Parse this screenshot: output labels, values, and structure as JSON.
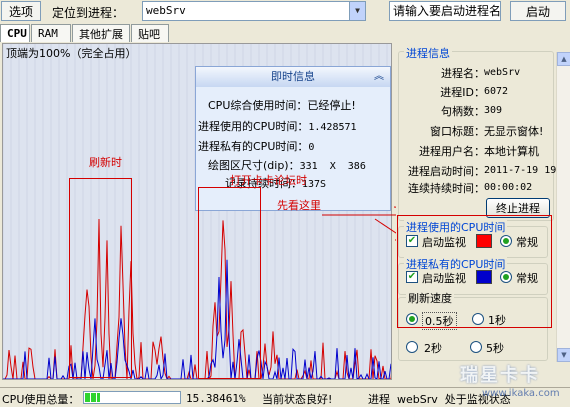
{
  "toolbar": {
    "options_label": "选项",
    "locate_label": "定位到进程：",
    "process_value": "webSrv",
    "start_placeholder": "请输入要启动进程名",
    "start_button": "启动"
  },
  "tabs": [
    "CPU",
    "RAM",
    "其他扩展",
    "贴吧"
  ],
  "graph": {
    "top_label": "顶端为100%（完全占用）",
    "series": [
      {
        "color": "#d40000",
        "label": "进程使用的CPU时间"
      },
      {
        "color": "#0000cc",
        "label": "进程私有的CPU时间"
      }
    ]
  },
  "info_panel": {
    "title": "即时信息",
    "rows": [
      {
        "label": "CPU综合使用时间：",
        "value": "已经停止!"
      },
      {
        "label": "进程使用的CPU时间：",
        "value": "1.428571"
      },
      {
        "label": "进程私有的CPU时间：",
        "value": "0"
      },
      {
        "label": "绘图区尺寸(dip)：",
        "value": "331  X  386"
      },
      {
        "label": "记录持续时间：",
        "value": "137S"
      }
    ]
  },
  "annotations": {
    "refresh": "刷新时",
    "open_lag": "打开卡卡论坛时",
    "look_here": "先看这里"
  },
  "process_info": {
    "title": "进程信息",
    "rows": [
      {
        "label": "进程名：",
        "value": "webSrv"
      },
      {
        "label": "进程ID：",
        "value": "6072"
      },
      {
        "label": "句柄数：",
        "value": "309"
      },
      {
        "label": "窗口标题：",
        "value": "无显示窗体!"
      },
      {
        "label": "进程用户名：",
        "value": "本地计算机"
      },
      {
        "label": "进程启动时间：",
        "value": "2011-7-19 19:5"
      },
      {
        "label": "连续持续时间：",
        "value": "00:00:02"
      }
    ],
    "end_button": "终止进程"
  },
  "cpu_used": {
    "title": "进程使用的CPU时间",
    "monitor_label": "启动监视",
    "color": "#ff0000",
    "mode_label": "常规"
  },
  "cpu_private": {
    "title": "进程私有的CPU时间",
    "monitor_label": "启动监视",
    "color": "#0000cc",
    "mode_label": "常规"
  },
  "refresh_speed": {
    "title": "刷新速度",
    "options": [
      "0.5秒",
      "1秒",
      "2秒",
      "5秒"
    ],
    "selected": "0.5秒"
  },
  "status": {
    "cpu_total_label": "CPU使用总量：",
    "cpu_total_value": "15.38461%",
    "cpu_total_fraction": 0.154,
    "state": "当前状态良好!",
    "monitor_text": "进程  webSrv  处于监视状态"
  },
  "watermark": {
    "brand": "瑞星卡卡",
    "url": "www.ikaka.com"
  }
}
